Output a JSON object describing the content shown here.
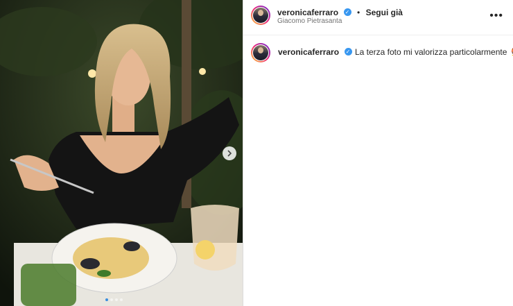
{
  "post": {
    "username": "veronicaferraro",
    "follow_label": "Segui già",
    "separator": "•",
    "location": "Giacomo Pietrasanta",
    "more_label": "•••",
    "caption": "La terza foto mi valorizza particolarmente",
    "caption_emoji": "🐓",
    "carousel": {
      "total": 4,
      "active": 0
    }
  },
  "icons": {
    "verified": "verified-badge-icon",
    "next": "chevron-right-icon",
    "more": "more-options-icon"
  },
  "colors": {
    "verified": "#3897f0",
    "text": "#262626",
    "muted": "#737373"
  }
}
